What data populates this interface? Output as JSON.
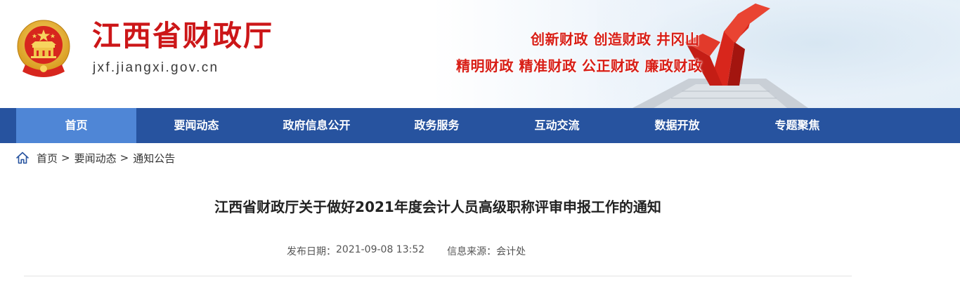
{
  "header": {
    "site_title": "江西省财政厅",
    "site_domain": "jxf.jiangxi.gov.cn",
    "slogan_line1": "创新财政  创造财政  井冈山",
    "slogan_line2": "精明财政  精准财政  公正财政  廉政财政",
    "brand_color": "#cc1618"
  },
  "nav": {
    "items": [
      {
        "label": "首页",
        "active": true
      },
      {
        "label": "要闻动态"
      },
      {
        "label": "政府信息公开"
      },
      {
        "label": "政务服务"
      },
      {
        "label": "互动交流"
      },
      {
        "label": "数据开放"
      },
      {
        "label": "专题聚焦"
      }
    ],
    "background": "#27539f",
    "active_background": "#4f86d6"
  },
  "breadcrumb": {
    "icon": "home-icon",
    "items": [
      "首页",
      "要闻动态",
      "通知公告"
    ],
    "separator": ">"
  },
  "article": {
    "title": "江西省财政厅关于做好2021年度会计人员高级职称评审申报工作的通知",
    "publish_label": "发布日期：",
    "publish_date": "2021-09-08 13:52",
    "source_label": "信息来源：",
    "source": "会计处"
  }
}
